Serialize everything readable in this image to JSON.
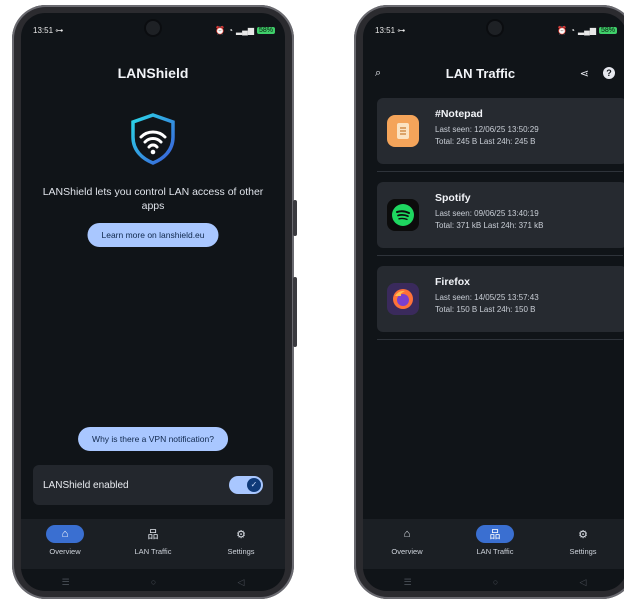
{
  "left": {
    "status": {
      "time": "13:51",
      "battery": "58%"
    },
    "title": "LANShield",
    "description": "LANShield lets you control LAN access of other apps",
    "learn_more": "Learn more on lanshield.eu",
    "vpn_button": "Why is there a VPN notification?",
    "toggle": {
      "label": "LANShield enabled",
      "on": true
    },
    "nav": [
      {
        "label": "Overview",
        "icon": "home-icon",
        "active": true
      },
      {
        "label": "LAN Traffic",
        "icon": "network-icon",
        "active": false
      },
      {
        "label": "Settings",
        "icon": "gear-icon",
        "active": false
      }
    ]
  },
  "right": {
    "status": {
      "time": "13:51",
      "battery": "58%"
    },
    "title": "LAN Traffic",
    "apps": [
      {
        "name": "#Notepad",
        "last_seen": "Last seen: 12/06/25 13:50:29",
        "totals": "Total: 245 B  Last 24h: 245 B",
        "icon": "notepad-icon",
        "color": "#f4a45a"
      },
      {
        "name": "Spotify",
        "last_seen": "Last seen: 09/06/25 13:40:19",
        "totals": "Total: 371 kB  Last 24h: 371 kB",
        "icon": "spotify-icon",
        "color": "#1ed760"
      },
      {
        "name": "Firefox",
        "last_seen": "Last seen: 14/05/25 13:57:43",
        "totals": "Total: 150 B  Last 24h: 150 B",
        "icon": "firefox-icon",
        "color": "#ff7139"
      }
    ],
    "nav": [
      {
        "label": "Overview",
        "icon": "home-icon",
        "active": false
      },
      {
        "label": "LAN Traffic",
        "icon": "network-icon",
        "active": true
      },
      {
        "label": "Settings",
        "icon": "gear-icon",
        "active": false
      }
    ]
  }
}
